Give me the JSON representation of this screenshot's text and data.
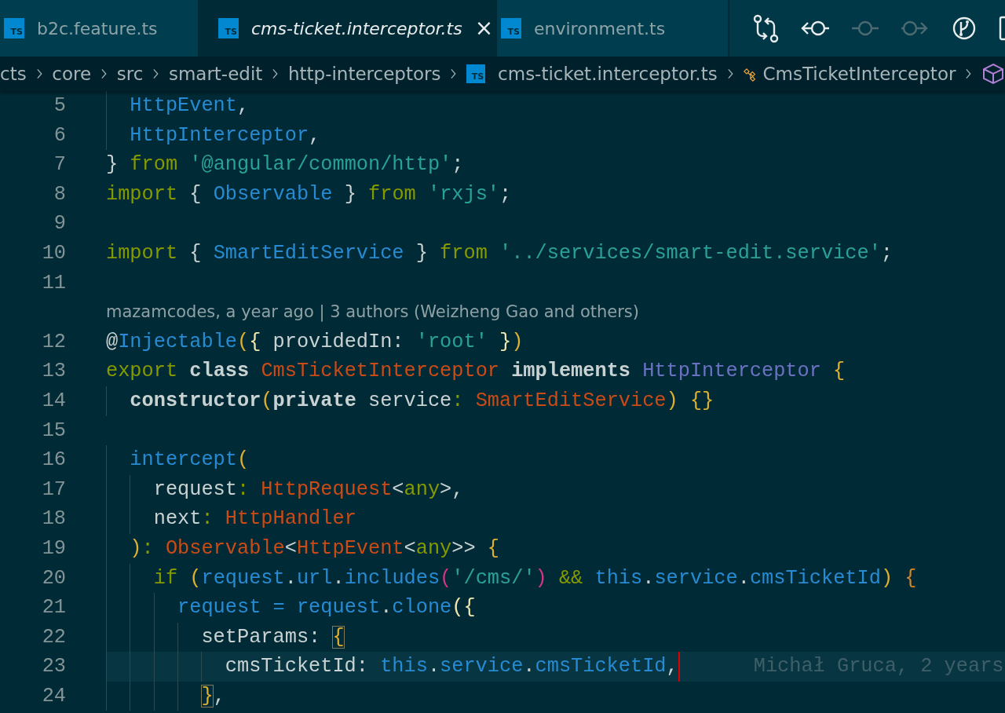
{
  "tabs": [
    {
      "label": "b2c.feature.ts",
      "icon_text": "TS",
      "selected": false,
      "preview": false
    },
    {
      "label": "cms-ticket.interceptor.ts",
      "icon_text": "TS",
      "selected": true,
      "preview": true,
      "close": "×"
    },
    {
      "label": "environment.ts",
      "icon_text": "TS",
      "selected": false,
      "preview": false
    }
  ],
  "toolbar": [
    {
      "kind": "compare",
      "disabled": false
    },
    {
      "kind": "previous",
      "disabled": false
    },
    {
      "kind": "commit",
      "disabled": true
    },
    {
      "kind": "next",
      "disabled": true
    },
    {
      "kind": "branch",
      "disabled": false
    },
    {
      "kind": "split",
      "disabled": false
    }
  ],
  "breadcrumbs": [
    {
      "kind": "folder",
      "label": "cts"
    },
    {
      "kind": "folder",
      "label": "core"
    },
    {
      "kind": "folder",
      "label": "src"
    },
    {
      "kind": "folder",
      "label": "smart-edit"
    },
    {
      "kind": "folder",
      "label": "http-interceptors"
    },
    {
      "kind": "file",
      "label": "cms-ticket.interceptor.ts",
      "icon_text": "TS"
    },
    {
      "kind": "class",
      "label": "CmsTicketInterceptor"
    },
    {
      "kind": "symbol"
    }
  ],
  "editor": {
    "lines": [
      {
        "kind": "code",
        "number": "5",
        "current": false,
        "tokens": [
          {
            "kind": "ident",
            "text": "  HttpEvent"
          },
          {
            "kind": "plain",
            "text": ","
          }
        ]
      },
      {
        "kind": "code",
        "number": "6",
        "current": false,
        "tokens": [
          {
            "kind": "ident",
            "text": "  HttpInterceptor"
          },
          {
            "kind": "plain",
            "text": ","
          }
        ]
      },
      {
        "kind": "code",
        "number": "7",
        "current": false,
        "tokens": [
          {
            "kind": "plain",
            "text": "}"
          },
          {
            "kind": "keyword",
            "text": " from"
          },
          {
            "kind": "string",
            "text": " '@angular/common/http'"
          },
          {
            "kind": "plain",
            "text": ";"
          }
        ]
      },
      {
        "kind": "code",
        "number": "8",
        "current": false,
        "tokens": [
          {
            "kind": "keyword",
            "text": "import"
          },
          {
            "kind": "plain",
            "text": " {"
          },
          {
            "kind": "ident",
            "text": " Observable"
          },
          {
            "kind": "plain",
            "text": " }"
          },
          {
            "kind": "keyword",
            "text": " from"
          },
          {
            "kind": "string",
            "text": " 'rxjs'"
          },
          {
            "kind": "plain",
            "text": ";"
          }
        ]
      },
      {
        "kind": "code",
        "number": "9",
        "current": false
      },
      {
        "kind": "code",
        "number": "10",
        "current": false,
        "tokens": [
          {
            "kind": "keyword",
            "text": "import"
          },
          {
            "kind": "plain",
            "text": " {"
          },
          {
            "kind": "ident",
            "text": " SmartEditService"
          },
          {
            "kind": "plain",
            "text": " }"
          },
          {
            "kind": "keyword",
            "text": " from"
          },
          {
            "kind": "string",
            "text": " '../services/smart-edit.service'"
          },
          {
            "kind": "plain",
            "text": ";"
          }
        ]
      },
      {
        "kind": "code",
        "number": "11",
        "current": false
      },
      {
        "kind": "lens",
        "text": "mazamcodes, a year ago | 3 authors (Weizheng Gao and others)"
      },
      {
        "kind": "code",
        "number": "12",
        "current": false,
        "tokens": [
          {
            "kind": "plain",
            "text": "@"
          },
          {
            "kind": "ident",
            "text": "Injectable"
          },
          {
            "kind": "bracket",
            "text": "("
          },
          {
            "kind": "brace",
            "text": "{"
          },
          {
            "kind": "plain",
            "text": " providedIn:"
          },
          {
            "kind": "string",
            "text": " 'root'"
          },
          {
            "kind": "brace",
            "text": " }"
          },
          {
            "kind": "bracket",
            "text": ")"
          }
        ]
      },
      {
        "kind": "code",
        "number": "13",
        "current": false,
        "tokens": [
          {
            "kind": "keyword",
            "text": "export"
          },
          {
            "kind": "storage",
            "text": " class"
          },
          {
            "kind": "type",
            "text": " CmsTicketInterceptor"
          },
          {
            "kind": "storage",
            "text": " implements"
          },
          {
            "kind": "interface",
            "text": " HttpInterceptor"
          },
          {
            "kind": "bracket",
            "text": " {"
          }
        ]
      },
      {
        "kind": "code",
        "number": "14",
        "current": false,
        "tokens": [
          {
            "kind": "storage",
            "text": "  constructor"
          },
          {
            "kind": "bracket",
            "text": "("
          },
          {
            "kind": "storage",
            "text": "private"
          },
          {
            "kind": "plain",
            "text": " service"
          },
          {
            "kind": "keyword",
            "text": ":"
          },
          {
            "kind": "type",
            "text": " SmartEditService"
          },
          {
            "kind": "bracket",
            "text": ")"
          },
          {
            "kind": "bracket",
            "text": " {}"
          }
        ]
      },
      {
        "kind": "code",
        "number": "15",
        "current": false
      },
      {
        "kind": "code",
        "number": "16",
        "current": false,
        "tokens": [
          {
            "kind": "ident",
            "text": "  intercept"
          },
          {
            "kind": "bracket",
            "text": "("
          }
        ]
      },
      {
        "kind": "code",
        "number": "17",
        "current": false,
        "tokens": [
          {
            "kind": "plain",
            "text": "    request"
          },
          {
            "kind": "keyword",
            "text": ":"
          },
          {
            "kind": "type",
            "text": " HttpRequest"
          },
          {
            "kind": "plain",
            "text": "<"
          },
          {
            "kind": "keyword",
            "text": "any"
          },
          {
            "kind": "plain",
            "text": ">,"
          }
        ]
      },
      {
        "kind": "code",
        "number": "18",
        "current": false,
        "tokens": [
          {
            "kind": "plain",
            "text": "    next"
          },
          {
            "kind": "keyword",
            "text": ":"
          },
          {
            "kind": "type",
            "text": " HttpHandler"
          }
        ]
      },
      {
        "kind": "code",
        "number": "19",
        "current": false,
        "tokens": [
          {
            "kind": "bracket",
            "text": "  )"
          },
          {
            "kind": "keyword",
            "text": ":"
          },
          {
            "kind": "type",
            "text": " Observable"
          },
          {
            "kind": "plain",
            "text": "<"
          },
          {
            "kind": "type",
            "text": "HttpEvent"
          },
          {
            "kind": "plain",
            "text": "<"
          },
          {
            "kind": "keyword",
            "text": "any"
          },
          {
            "kind": "plain",
            "text": ">>"
          },
          {
            "kind": "bracket",
            "text": " {"
          }
        ]
      },
      {
        "kind": "code",
        "number": "20",
        "current": false,
        "tokens": [
          {
            "kind": "keyword",
            "text": "    if"
          },
          {
            "kind": "bracket",
            "text": " ("
          },
          {
            "kind": "ident",
            "text": "request"
          },
          {
            "kind": "plain",
            "text": "."
          },
          {
            "kind": "ident",
            "text": "url"
          },
          {
            "kind": "plain",
            "text": "."
          },
          {
            "kind": "ident",
            "text": "includes"
          },
          {
            "kind": "paren",
            "text": "("
          },
          {
            "kind": "string",
            "text": "'/cms/'"
          },
          {
            "kind": "paren",
            "text": ")"
          },
          {
            "kind": "keyword",
            "text": " &&"
          },
          {
            "kind": "ident",
            "text": " this"
          },
          {
            "kind": "plain",
            "text": "."
          },
          {
            "kind": "ident",
            "text": "service"
          },
          {
            "kind": "plain",
            "text": "."
          },
          {
            "kind": "ident",
            "text": "cmsTicketId"
          },
          {
            "kind": "bracket",
            "text": ")"
          },
          {
            "kind": "orangebrace",
            "text": " {"
          }
        ]
      },
      {
        "kind": "code",
        "number": "21",
        "current": false,
        "tokens": [
          {
            "kind": "ident",
            "text": "      request"
          },
          {
            "kind": "ident",
            "text": " ="
          },
          {
            "kind": "ident",
            "text": " request"
          },
          {
            "kind": "plain",
            "text": "."
          },
          {
            "kind": "ident",
            "text": "clone"
          },
          {
            "kind": "brace",
            "text": "({"
          }
        ]
      },
      {
        "kind": "code",
        "number": "22",
        "current": false,
        "tokens": [
          {
            "kind": "plain",
            "text": "        setParams:"
          },
          {
            "kind": "match",
            "text": " {"
          }
        ]
      },
      {
        "kind": "code",
        "number": "23",
        "current": true,
        "blame": "Michał Gruca, 2 years",
        "tokens": [
          {
            "kind": "plain",
            "text": "          cmsTicketId:"
          },
          {
            "kind": "ident",
            "text": " this"
          },
          {
            "kind": "plain",
            "text": "."
          },
          {
            "kind": "ident",
            "text": "service"
          },
          {
            "kind": "plain",
            "text": "."
          },
          {
            "kind": "ident",
            "text": "cmsTicketId"
          },
          {
            "kind": "plain",
            "text": ","
          }
        ]
      },
      {
        "kind": "code",
        "number": "24",
        "current": false,
        "tokens": [
          {
            "kind": "match",
            "text": "        }"
          },
          {
            "kind": "plain",
            "text": ","
          }
        ]
      }
    ]
  }
}
